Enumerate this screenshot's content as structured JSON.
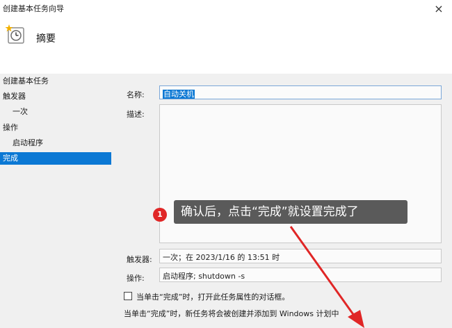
{
  "window": {
    "title": "创建基本任务向导",
    "close_glyph": "×"
  },
  "header": {
    "heading": "摘要",
    "icon": "task-clock-icon"
  },
  "sidebar": {
    "items": [
      {
        "label": "创建基本任务",
        "indent": 0,
        "selected": false
      },
      {
        "label": "触发器",
        "indent": 0,
        "selected": false
      },
      {
        "label": "一次",
        "indent": 1,
        "selected": false
      },
      {
        "label": "操作",
        "indent": 0,
        "selected": false
      },
      {
        "label": "启动程序",
        "indent": 1,
        "selected": false
      },
      {
        "label": "完成",
        "indent": 0,
        "selected": true
      }
    ]
  },
  "form": {
    "name_label": "名称:",
    "name_value": "自动关机",
    "description_label": "描述:",
    "description_value": "",
    "trigger_label": "触发器:",
    "trigger_value": "一次；在 2023/1/16 的 13:51 时",
    "action_label": "操作:",
    "action_value": "启动程序; shutdown -s"
  },
  "options": {
    "open_properties_label": "当单击“完成”时，打开此任务属性的对话框。",
    "open_properties_checked": false,
    "finish_note": "当单击“完成”时，新任务将会被创建并添加到 Windows 计划中"
  },
  "annotation": {
    "number": "1",
    "text": "确认后，点击“完成”就设置完成了"
  },
  "colors": {
    "selection": "#0b78d4",
    "annotation_red": "#e02626",
    "annotation_box": "#5a5a5a"
  }
}
